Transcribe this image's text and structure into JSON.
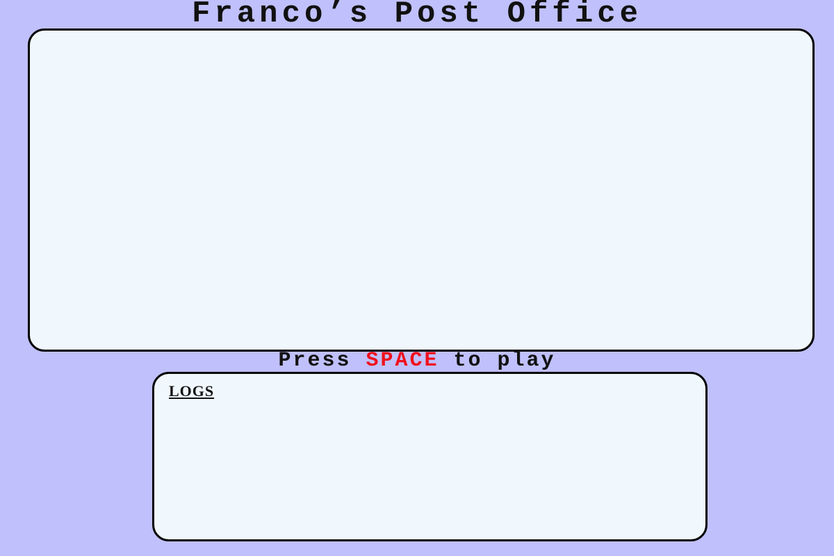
{
  "game": {
    "title": "Franco’s Post Office",
    "prompt_before": "Press ",
    "prompt_key": "SPACE",
    "prompt_after": " to play"
  },
  "logs": {
    "heading": "LOGS",
    "entries": []
  },
  "colors": {
    "background": "#c0c0fc",
    "panel": "#f0f8fe",
    "border": "#000000",
    "key_highlight": "#f0101c"
  }
}
